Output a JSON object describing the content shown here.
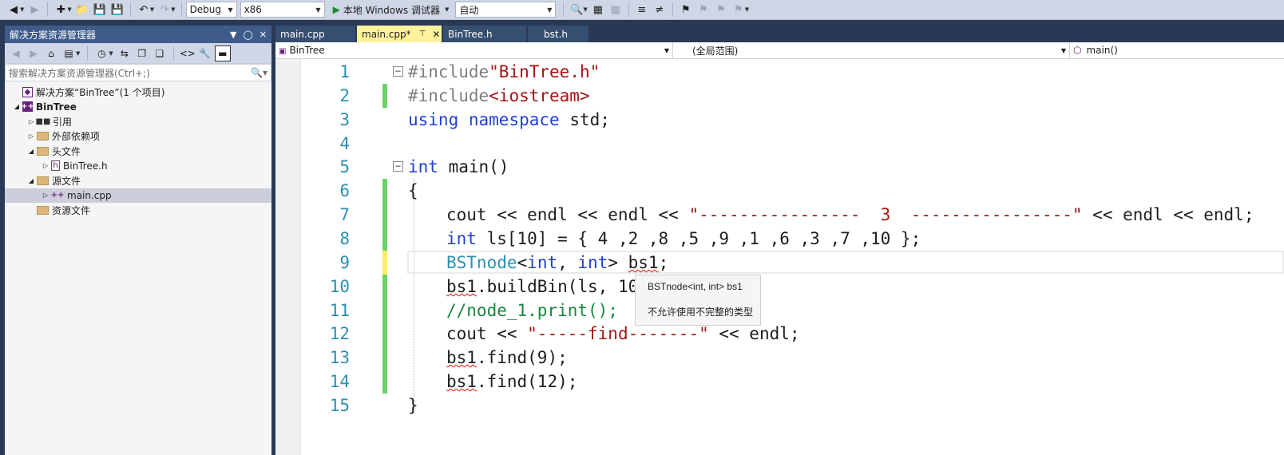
{
  "toolbar": {
    "config": "Debug",
    "platform": "x86",
    "run_label": "本地 Windows 调试器",
    "run_mode": "自动"
  },
  "explorer": {
    "title": "解决方案资源管理器",
    "search_placeholder": "搜索解决方案资源管理器(Ctrl+;)",
    "items": [
      {
        "label": "解决方案“BinTree”(1 个项目)"
      },
      {
        "label": "BinTree"
      },
      {
        "label": "引用"
      },
      {
        "label": "外部依赖项"
      },
      {
        "label": "头文件"
      },
      {
        "label": "BinTree.h"
      },
      {
        "label": "源文件"
      },
      {
        "label": "main.cpp"
      },
      {
        "label": "资源文件"
      }
    ]
  },
  "tabs": [
    {
      "label": "main.cpp"
    },
    {
      "label": "main.cpp*"
    },
    {
      "label": "BinTree.h"
    },
    {
      "label": "bst.h"
    }
  ],
  "navbar": {
    "project": "BinTree",
    "scope": "(全局范围)",
    "member": "main()"
  },
  "code": {
    "lines": [
      "1",
      "2",
      "3",
      "4",
      "5",
      "6",
      "7",
      "8",
      "9",
      "10",
      "11",
      "12",
      "13",
      "14",
      "15"
    ]
  },
  "tooltip": {
    "signature": "BSTnode<int, int> bs1",
    "message": "不允许使用不完整的类型"
  },
  "colors": {
    "keyword": "#1f3fd6",
    "string": "#a31515",
    "comment": "#15883e",
    "type": "#2b91af",
    "change_saved": "#6ad36a",
    "change_unsaved": "#ffee62"
  }
}
